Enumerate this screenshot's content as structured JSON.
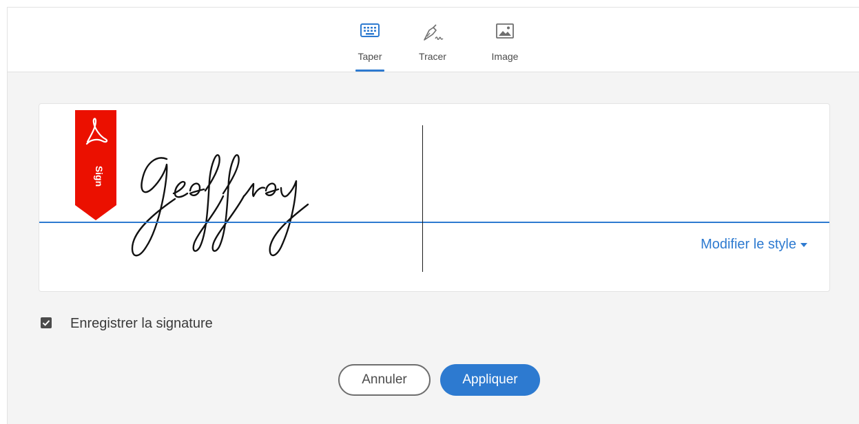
{
  "tabs": [
    {
      "label": "Taper",
      "icon": "keyboard-icon",
      "active": true
    },
    {
      "label": "Tracer",
      "icon": "pen-draw-icon",
      "active": false
    },
    {
      "label": "Image",
      "icon": "image-icon",
      "active": false
    }
  ],
  "signature_panel": {
    "ribbon_text": "Sign",
    "signature_text": "Geoffroy",
    "modify_style_label": "Modifier le style"
  },
  "save_signature": {
    "label": "Enregistrer la signature",
    "checked": true
  },
  "buttons": {
    "cancel_label": "Annuler",
    "apply_label": "Appliquer"
  },
  "colors": {
    "accent": "#2d7ad0",
    "ribbon_red": "#eb1000",
    "panel_bg": "#f4f4f4"
  }
}
